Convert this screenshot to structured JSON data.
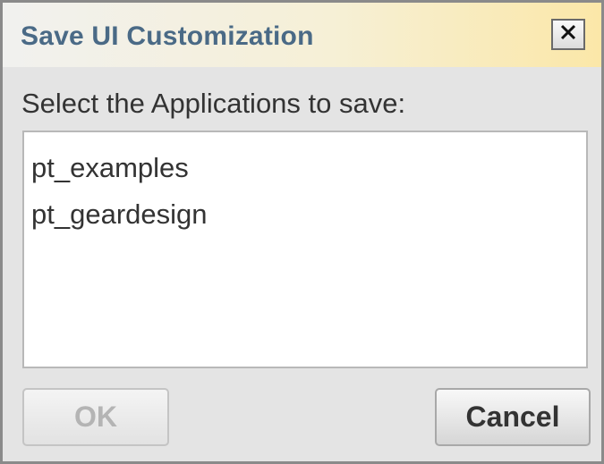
{
  "dialog": {
    "title": "Save UI Customization",
    "close_icon": "close-x-icon",
    "prompt": "Select the Applications to save:",
    "applications": [
      "pt_examples",
      "pt_geardesign"
    ],
    "buttons": {
      "ok_label": "OK",
      "ok_enabled": false,
      "cancel_label": "Cancel"
    }
  },
  "colors": {
    "title_text": "#4a6a86",
    "title_gradient_end": "#fbe7a8",
    "dialog_background": "#e4e4e4",
    "text": "#333333",
    "disabled_text": "#b4b4b4"
  }
}
